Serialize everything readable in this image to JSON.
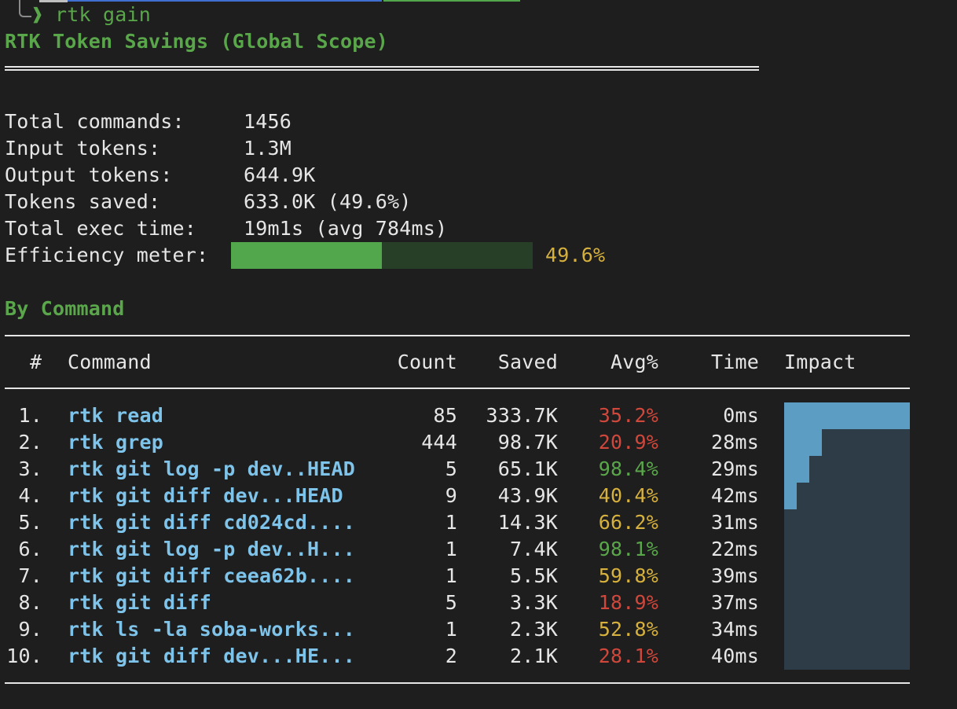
{
  "prompt": {
    "symbol": "❱",
    "command": "rtk gain"
  },
  "title": "RTK Token Savings (Global Scope)",
  "summary": {
    "rows": [
      {
        "label": "Total commands:",
        "value": "1456"
      },
      {
        "label": "Input tokens:",
        "value": "1.3M"
      },
      {
        "label": "Output tokens:",
        "value": "644.9K"
      },
      {
        "label": "Tokens saved:",
        "value": "633.0K (49.6%)"
      },
      {
        "label": "Total exec time:",
        "value": "19m1s (avg 784ms)"
      }
    ],
    "meter_label": "Efficiency meter:",
    "meter_value": "49.6%",
    "meter_fraction": 0.5
  },
  "by_command": {
    "heading": "By Command",
    "headers": {
      "num": "#",
      "command": "Command",
      "count": "Count",
      "saved": "Saved",
      "avg": "Avg%",
      "time": "Time",
      "impact": "Impact"
    },
    "rows": [
      {
        "num": "1.",
        "command": "rtk read",
        "count": "85",
        "saved": "333.7K",
        "avg": "35.2%",
        "avg_color": "red",
        "time": "0ms",
        "impact": 1.0
      },
      {
        "num": "2.",
        "command": "rtk grep",
        "count": "444",
        "saved": "98.7K",
        "avg": "20.9%",
        "avg_color": "red",
        "time": "28ms",
        "impact": 0.3
      },
      {
        "num": "3.",
        "command": "rtk git log -p dev..HEAD",
        "count": "5",
        "saved": "65.1K",
        "avg": "98.4%",
        "avg_color": "green",
        "time": "29ms",
        "impact": 0.2
      },
      {
        "num": "4.",
        "command": "rtk git diff dev...HEAD",
        "count": "9",
        "saved": "43.9K",
        "avg": "40.4%",
        "avg_color": "yellow",
        "time": "42ms",
        "impact": 0.1
      },
      {
        "num": "5.",
        "command": "rtk git diff cd024cd....",
        "count": "1",
        "saved": "14.3K",
        "avg": "66.2%",
        "avg_color": "yellow",
        "time": "31ms",
        "impact": 0.0
      },
      {
        "num": "6.",
        "command": "rtk git log -p dev..H...",
        "count": "1",
        "saved": "7.4K",
        "avg": "98.1%",
        "avg_color": "green",
        "time": "22ms",
        "impact": 0.0
      },
      {
        "num": "7.",
        "command": "rtk git diff ceea62b....",
        "count": "1",
        "saved": "5.5K",
        "avg": "59.8%",
        "avg_color": "yellow",
        "time": "39ms",
        "impact": 0.0
      },
      {
        "num": "8.",
        "command": "rtk git diff",
        "count": "5",
        "saved": "3.3K",
        "avg": "18.9%",
        "avg_color": "red",
        "time": "37ms",
        "impact": 0.0
      },
      {
        "num": "9.",
        "command": "rtk ls -la soba-works...",
        "count": "1",
        "saved": "2.3K",
        "avg": "52.8%",
        "avg_color": "yellow",
        "time": "34ms",
        "impact": 0.0
      },
      {
        "num": "10.",
        "command": "rtk git diff dev...HE...",
        "count": "2",
        "saved": "2.1K",
        "avg": "28.1%",
        "avg_color": "red",
        "time": "40ms",
        "impact": 0.0
      }
    ]
  },
  "colors": {
    "green": "#5aa64a",
    "yellow": "#d7b13d",
    "red": "#d0473c",
    "command_blue": "#7ec3ea",
    "impact_bar": "#5b9dc3",
    "impact_bg": "#2e3c48"
  }
}
